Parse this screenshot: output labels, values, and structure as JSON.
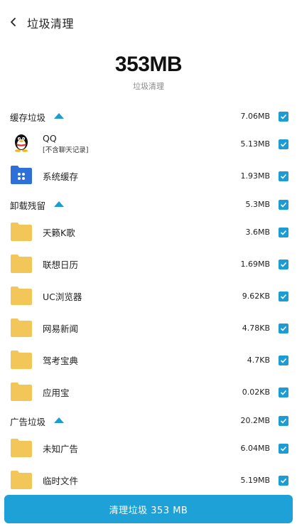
{
  "header": {
    "title": "垃圾清理"
  },
  "summary": {
    "size": "353MB",
    "label": "垃圾清理"
  },
  "colors": {
    "accent": "#1d9bd3",
    "folder": "#f3c65a",
    "button": "#1da1d6"
  },
  "sections": [
    {
      "title": "缓存垃圾",
      "size": "7.06MB",
      "checked": true,
      "items": [
        {
          "name": "QQ",
          "sub": "[不含聊天记录]",
          "size": "5.13MB",
          "icon": "qq-penguin-icon",
          "checked": true
        },
        {
          "name": "系统缓存",
          "size": "1.93MB",
          "icon": "system-cache-icon",
          "checked": true
        }
      ]
    },
    {
      "title": "卸载残留",
      "size": "5.3MB",
      "checked": true,
      "items": [
        {
          "name": "天籁K歌",
          "size": "3.6MB",
          "icon": "folder-icon",
          "checked": true
        },
        {
          "name": "联想日历",
          "size": "1.69MB",
          "icon": "folder-icon",
          "checked": true
        },
        {
          "name": "UC浏览器",
          "size": "9.62KB",
          "icon": "folder-icon",
          "checked": true
        },
        {
          "name": "网易新闻",
          "size": "4.78KB",
          "icon": "folder-icon",
          "checked": true
        },
        {
          "name": "驾考宝典",
          "size": "4.7KB",
          "icon": "folder-icon",
          "checked": true
        },
        {
          "name": "应用宝",
          "size": "0.02KB",
          "icon": "folder-icon",
          "checked": true
        }
      ]
    },
    {
      "title": "广告垃圾",
      "size": "20.2MB",
      "checked": true,
      "items": [
        {
          "name": "未知广告",
          "size": "6.04MB",
          "icon": "folder-icon",
          "checked": true
        },
        {
          "name": "临时文件",
          "size": "5.19MB",
          "icon": "folder-icon",
          "checked": true
        }
      ]
    }
  ],
  "button": {
    "label": "清理垃圾 353 MB"
  }
}
